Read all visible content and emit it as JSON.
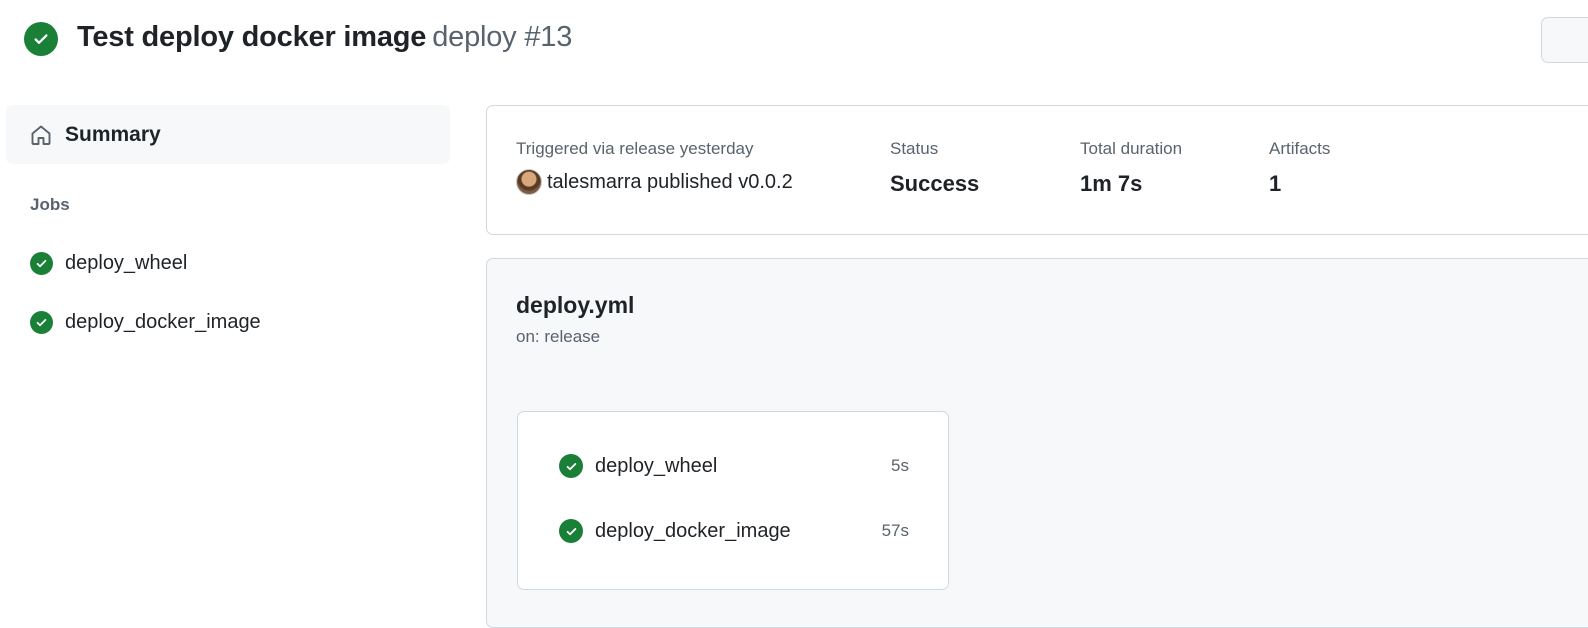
{
  "header": {
    "workflow_title": "Test deploy docker image",
    "run_label": "deploy #13",
    "status_icon": "check-circle-fill"
  },
  "sidebar": {
    "summary_label": "Summary",
    "summary_icon": "home-icon",
    "jobs_heading": "Jobs",
    "jobs": [
      {
        "name": "deploy_wheel",
        "status": "success"
      },
      {
        "name": "deploy_docker_image",
        "status": "success"
      }
    ]
  },
  "run_info": {
    "trigger_label": "Triggered via release yesterday",
    "actor": "talesmarra",
    "action_text": "published v0.0.2",
    "status_label": "Status",
    "status_value": "Success",
    "duration_label": "Total duration",
    "duration_value": "1m 7s",
    "artifacts_label": "Artifacts",
    "artifacts_value": "1"
  },
  "workflow_graph": {
    "file_name": "deploy.yml",
    "trigger": "on: release",
    "jobs": [
      {
        "name": "deploy_wheel",
        "duration": "5s",
        "status": "success"
      },
      {
        "name": "deploy_docker_image",
        "duration": "57s",
        "status": "success"
      }
    ]
  },
  "colors": {
    "success": "#1a7f37",
    "muted_text": "#59636e",
    "border": "#d1d9e0",
    "panel_bg": "#f6f8fa"
  }
}
